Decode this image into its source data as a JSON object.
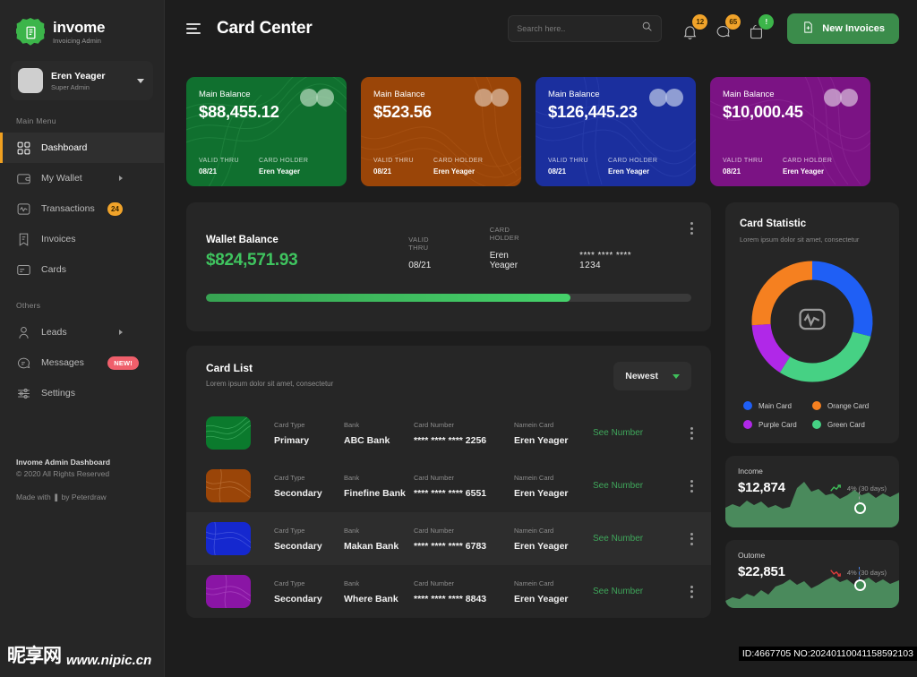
{
  "brand": {
    "name": "invome",
    "tagline": "Invoicing Admin",
    "logo_icon": "invoice-logo-icon"
  },
  "user": {
    "name": "Eren Yeager",
    "role": "Super Admin"
  },
  "sidebar": {
    "section_main": "Main Menu",
    "section_others": "Others",
    "main_items": [
      {
        "label": "Dashboard",
        "icon": "grid-icon",
        "active": true
      },
      {
        "label": "My Wallet",
        "icon": "wallet-icon",
        "arrow": true
      },
      {
        "label": "Transactions",
        "icon": "activity-icon",
        "badge": "24"
      },
      {
        "label": "Invoices",
        "icon": "invoice-icon"
      },
      {
        "label": "Cards",
        "icon": "card-icon"
      }
    ],
    "other_items": [
      {
        "label": "Leads",
        "icon": "user-icon",
        "arrow": true
      },
      {
        "label": "Messages",
        "icon": "chat-icon",
        "badge_new": "NEW!"
      },
      {
        "label": "Settings",
        "icon": "settings-icon"
      }
    ],
    "footer": {
      "title": "Invome Admin Dashboard",
      "copyright": "© 2020 All Rights Reserved",
      "credit": "Made with ❚ by Peterdraw"
    }
  },
  "header": {
    "menu_icon": "hamburger-icon",
    "title": "Card Center",
    "search": {
      "placeholder": "Search here..",
      "value": "",
      "icon": "search-icon"
    },
    "icons": [
      {
        "name": "bell-icon",
        "badge": "12",
        "badge_color": "#f0a32a"
      },
      {
        "name": "chat-icon",
        "badge": "65",
        "badge_color": "#f0a32a"
      },
      {
        "name": "bag-icon",
        "badge": "!",
        "badge_color": "#3cb54a"
      }
    ],
    "new_invoices_label": "New Invoices",
    "new_invoices_icon": "file-plus-icon",
    "accent_green": "#3b8c4b"
  },
  "bank_cards": [
    {
      "label": "Main Balance",
      "amount": "$88,455.12",
      "valid_label": "VALID THRU",
      "valid": "08/21",
      "holder_label": "CARD HOLDER",
      "holder": "Eren Yeager",
      "color": "#10702f",
      "theme": "green"
    },
    {
      "label": "Main Balance",
      "amount": "$523.56",
      "valid_label": "VALID THRU",
      "valid": "08/21",
      "holder_label": "CARD HOLDER",
      "holder": "Eren Yeager",
      "color": "#9a4508",
      "theme": "orange"
    },
    {
      "label": "Main Balance",
      "amount": "$126,445.23",
      "valid_label": "VALID THRU",
      "valid": "08/21",
      "holder_label": "CARD HOLDER",
      "holder": "Eren Yeager",
      "color": "#1b2f9e",
      "theme": "blue"
    },
    {
      "label": "Main Balance",
      "amount": "$10,000.45",
      "valid_label": "VALID THRU",
      "valid": "08/21",
      "holder_label": "CARD HOLDER",
      "holder": "Eren Yeager",
      "color": "#7b1384",
      "theme": "purple"
    }
  ],
  "wallet": {
    "title": "Wallet Balance",
    "amount": "$824,571.93",
    "valid_label": "VALID THRU",
    "valid": "08/21",
    "holder_label": "CARD HOLDER",
    "holder": "Eren Yeager",
    "card_number": "**** **** **** 1234",
    "progress_percent": 75,
    "menu_icon": "kebab-menu-icon"
  },
  "card_list": {
    "title": "Card List",
    "subtitle": "Lorem ipsum dolor sit amet, consectetur",
    "sort_label": "Newest",
    "sort_icon": "chevron-down-icon",
    "columns": {
      "type": "Card Type",
      "bank": "Bank",
      "number": "Card Number",
      "name": "Namein Card"
    },
    "action_label": "See Number",
    "rows": [
      {
        "type": "Primary",
        "bank": "ABC Bank",
        "number": "**** **** **** 2256",
        "name": "Eren Yeager",
        "theme": "green",
        "highlight": false
      },
      {
        "type": "Secondary",
        "bank": "Finefine Bank",
        "number": "**** **** **** 6551",
        "name": "Eren Yeager",
        "theme": "orange",
        "highlight": false
      },
      {
        "type": "Secondary",
        "bank": "Makan Bank",
        "number": "**** **** **** 6783",
        "name": "Eren Yeager",
        "theme": "blue",
        "highlight": true
      },
      {
        "type": "Secondary",
        "bank": "Where Bank",
        "number": "**** **** **** 8843",
        "name": "Eren Yeager",
        "theme": "purple",
        "highlight": false
      }
    ]
  },
  "card_statistic": {
    "title": "Card Statistic",
    "subtitle": "Lorem ipsum dolor sit amet, consectetur",
    "center_icon": "activity-monitor-icon"
  },
  "income": {
    "label": "Income",
    "amount": "$12,874",
    "delta": "4% (30 days)",
    "trend": "up",
    "trend_color": "#3fbf5a"
  },
  "outcome": {
    "label": "Outome",
    "amount": "$22,851",
    "delta": "4% (30 days)",
    "trend": "down",
    "trend_color": "#e03b3b"
  },
  "watermark": {
    "site_cn": "昵享网",
    "site_url": "www.nipic.cn",
    "id_text": "ID:4667705 NO:20240110041158592103"
  },
  "chart_data": {
    "type": "pie",
    "title": "Card Statistic",
    "subtitle": "Lorem ipsum dolor sit amet, consectetur",
    "legend_position": "bottom",
    "labels": [
      "Main Card",
      "Green Card",
      "Purple Card",
      "Orange Card"
    ],
    "values": [
      29,
      30,
      15,
      26
    ],
    "colors": [
      "#1f5ff5",
      "#46d184",
      "#b028e8",
      "#f58020"
    ],
    "donut": true,
    "start_angle": 0
  }
}
